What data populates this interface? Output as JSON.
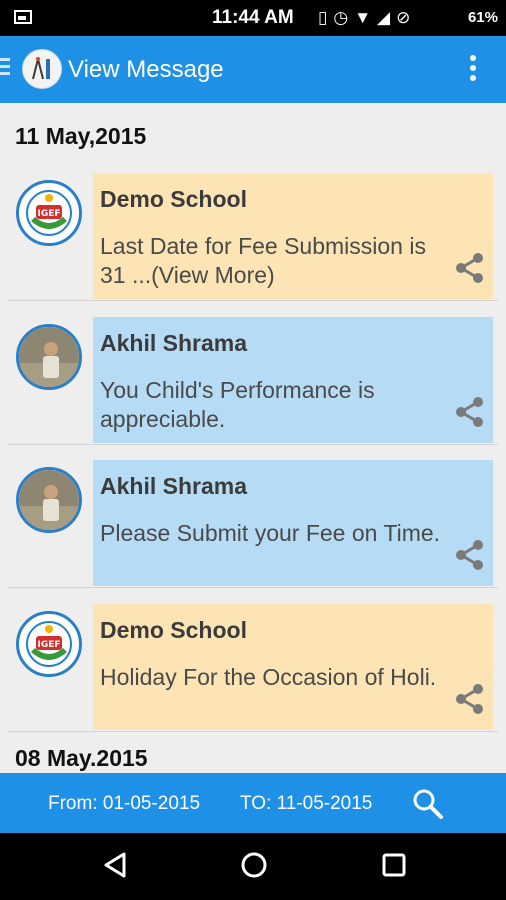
{
  "status_bar": {
    "time": "11:44 AM",
    "battery": "61%",
    "icons": [
      "picture-icon",
      "vibrate-icon",
      "alarm-icon",
      "wifi-icon",
      "signal-icon",
      "no-sim-icon",
      "battery-icon"
    ]
  },
  "app_bar": {
    "title": "View Message"
  },
  "date_headers": [
    "11 May,2015",
    "08 May.2015"
  ],
  "messages": [
    {
      "sender": "Demo  School",
      "text": "Last Date for Fee Submission is 31 ...(View More)",
      "type": "school",
      "avatar": "school-logo"
    },
    {
      "sender": "Akhil Shrama",
      "text": "You Child's Performance is appreciable.",
      "type": "teacher",
      "avatar": "teacher-photo"
    },
    {
      "sender": "Akhil Shrama",
      "text": "Please Submit your Fee on Time.",
      "type": "teacher",
      "avatar": "teacher-photo"
    },
    {
      "sender": "Demo  School",
      "text": "Holiday For the Occasion of Holi.",
      "type": "school",
      "avatar": "school-logo"
    }
  ],
  "filter_bar": {
    "from": "From: 01-05-2015",
    "to": "TO: 11-05-2015"
  },
  "colors": {
    "primary": "#1e90e6",
    "school_bubble": "#fde4b4",
    "teacher_bubble": "#b6dcf5",
    "background": "#eeeeee"
  },
  "logo_text": "IGEF"
}
